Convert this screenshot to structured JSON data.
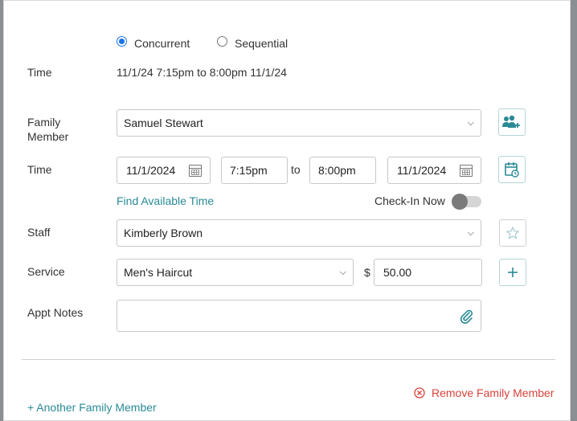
{
  "mode": {
    "options": [
      {
        "label": "Concurrent",
        "selected": true
      },
      {
        "label": "Sequential",
        "selected": false
      }
    ]
  },
  "summary": {
    "label": "Time",
    "value": "11/1/24 7:15pm to 8:00pm 11/1/24"
  },
  "family_member": {
    "label_line1": "Family",
    "label_line2": "Member",
    "selected": "Samuel Stewart"
  },
  "time": {
    "label": "Time",
    "start_date": "11/1/2024",
    "start_time": "7:15pm",
    "to_label": "to",
    "end_time": "8:00pm",
    "end_date": "11/1/2024"
  },
  "find_available_time": "Find Available Time",
  "check_in_now": {
    "label": "Check-In Now",
    "on": false
  },
  "staff": {
    "label": "Staff",
    "selected": "Kimberly Brown"
  },
  "service": {
    "label": "Service",
    "selected": "Men's Haircut",
    "currency": "$",
    "price": "50.00"
  },
  "appt_notes": {
    "label": "Appt Notes",
    "value": ""
  },
  "footer": {
    "add_family_member": "+ Another Family Member",
    "remove_family_member": "Remove Family Member"
  },
  "colors": {
    "teal": "#2a8a96",
    "red": "#d9433a",
    "radio_blue": "#1a73e8"
  }
}
